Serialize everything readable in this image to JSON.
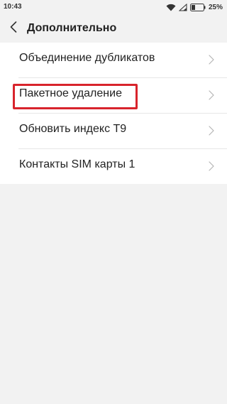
{
  "status_bar": {
    "time": "10:43",
    "battery_percent": "25%",
    "icons": [
      "wifi-icon",
      "signal-icon",
      "battery-icon"
    ]
  },
  "header": {
    "back_icon": "chevron-left-icon",
    "title": "Дополнительно"
  },
  "menu": {
    "items": [
      {
        "label": "Объединение дубликатов",
        "icon": "chevron-right-icon"
      },
      {
        "label": "Пакетное удаление",
        "icon": "chevron-right-icon",
        "highlighted": true
      },
      {
        "label": "Обновить индекс T9",
        "icon": "chevron-right-icon"
      },
      {
        "label": "Контакты SIM карты 1",
        "icon": "chevron-right-icon"
      }
    ]
  },
  "colors": {
    "background": "#f2f2f2",
    "list_background": "#ffffff",
    "highlight": "#d8242c",
    "text": "#222222"
  }
}
